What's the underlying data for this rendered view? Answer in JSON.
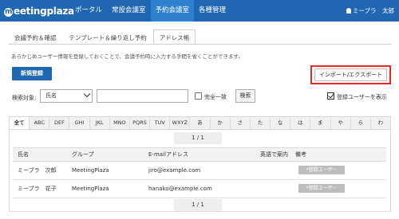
{
  "header": {
    "logo": "meetingplaza",
    "nav": [
      "ポータル",
      "常設会議室",
      "予約会議室",
      "各種管理"
    ],
    "active_nav": 2,
    "user": "ミープラ　太郎"
  },
  "tabs": [
    "会議予約＆確認",
    "テンプレート＆繰り返し予約",
    "アドレス帳"
  ],
  "active_tab": 2,
  "description": "あらかじめユーザー情報を登録しておくことで、会議予約時に入力する手間を省くことができます。",
  "buttons": {
    "new": "新規登録",
    "import_export": "インポート/エクスポート",
    "search": "検索"
  },
  "search": {
    "label": "検索対象:",
    "target": "氏名",
    "query": "",
    "exact_label": "完全一致",
    "exact_checked": false,
    "registered_label": "登録ユーザーを表示",
    "registered_checked": true
  },
  "alphabet_tabs": [
    "全て",
    "ABC",
    "DEF",
    "GHI",
    "JKL",
    "MNO",
    "PQRS",
    "TUV",
    "WXYZ",
    "あ",
    "か",
    "さ",
    "た",
    "な",
    "は",
    "ま",
    "や",
    "ら",
    "わ"
  ],
  "pager": "1 / 1",
  "table": {
    "columns": [
      "氏名",
      "グループ",
      "E-mailアドレス",
      "英語で案内",
      "備考"
    ],
    "rows": [
      {
        "name": "ミープラ　次郎",
        "group": "MeetingPlaza",
        "email": "jiro@example.com",
        "english": "",
        "badge": "*登録ユーザー"
      },
      {
        "name": "ミープラ　花子",
        "group": "MeetingPlaza",
        "email": "hanako@example.com",
        "english": "",
        "badge": "*登録ユーザー"
      }
    ]
  }
}
